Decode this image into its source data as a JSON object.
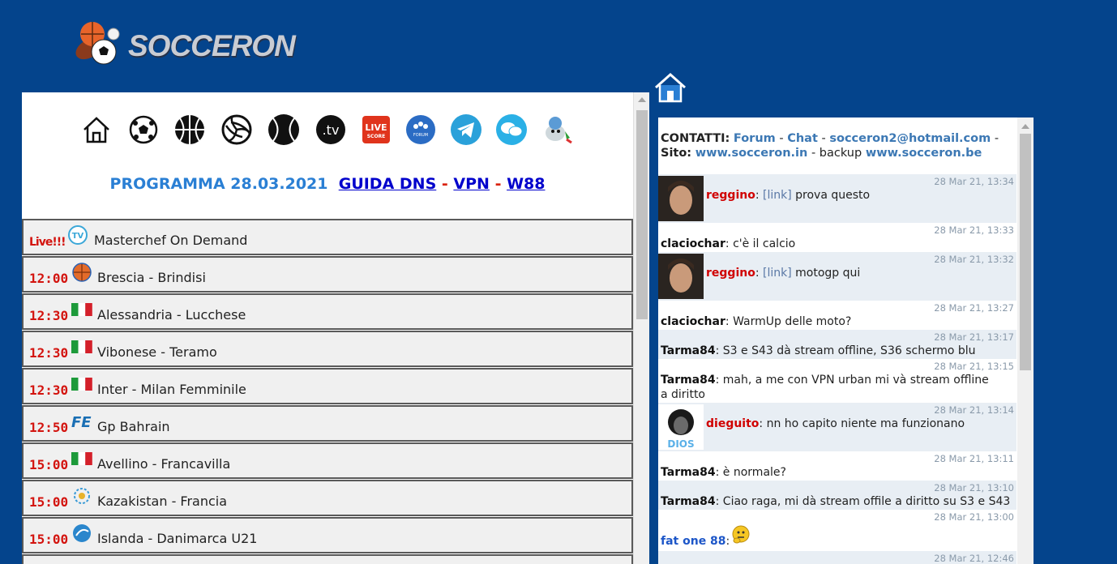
{
  "logo": {
    "text": "SOCCERON"
  },
  "nav_icons": [
    "home-icon",
    "soccer-ball-icon",
    "basketball-icon",
    "volleyball-icon",
    "tennis-ball-icon",
    "tv-icon",
    "live-score-icon",
    "forum-icon",
    "telegram-icon",
    "chat-bubble-icon",
    "mascot-icon"
  ],
  "live_score_label": {
    "line1": "LIVE",
    "line2": "SCORE"
  },
  "tv_label": ".tv",
  "forum_label": "FORUM",
  "programma": {
    "title": "PROGRAMMA 28.03.2021",
    "links": [
      "GUIDA DNS",
      "VPN",
      "W88"
    ],
    "sep": "-"
  },
  "events": [
    {
      "time": "Live!!!",
      "icon": "tv-channel-icon",
      "title": "Masterchef On Demand"
    },
    {
      "time": "12:00",
      "icon": "basketball-icon",
      "title": "Brescia - Brindisi"
    },
    {
      "time": "12:30",
      "icon": "italy-flag-icon",
      "title": "Alessandria - Lucchese"
    },
    {
      "time": "12:30",
      "icon": "italy-flag-icon",
      "title": "Vibonese - Teramo"
    },
    {
      "time": "12:30",
      "icon": "italy-flag-icon",
      "title": "Inter - Milan Femminile"
    },
    {
      "time": "12:50",
      "icon": "formula-e-icon",
      "title": "Gp Bahrain"
    },
    {
      "time": "15:00",
      "icon": "italy-flag-icon",
      "title": "Avellino - Francavilla"
    },
    {
      "time": "15:00",
      "icon": "world-cup-qualifier-icon",
      "title": "Kazakistan - Francia"
    },
    {
      "time": "15:00",
      "icon": "under21-icon",
      "title": "Islanda - Danimarca U21"
    }
  ],
  "chat": {
    "contacts_label": "CONTATTI:",
    "forum": "Forum",
    "chat": "Chat",
    "email": "socceron2@hotmail.com",
    "sito_label": "Sito:",
    "site1": "www.socceron.in",
    "backup_label": "backup",
    "site2": "www.socceron.be",
    "messages": [
      {
        "user": "reggino",
        "ts": "28 Mar 21, 13:34",
        "text": "prova questo",
        "link": "[link]"
      },
      {
        "user": "claciochar",
        "ts": "28 Mar 21, 13:33",
        "text": "c'è il calcio"
      },
      {
        "user": "reggino",
        "ts": "28 Mar 21, 13:32",
        "text": "motogp qui",
        "link": "[link]"
      },
      {
        "user": "claciochar",
        "ts": "28 Mar 21, 13:27",
        "text": "WarmUp delle moto?"
      },
      {
        "user": "Tarma84",
        "ts": "28 Mar 21, 13:17",
        "text": "S3 e S43 dà stream offline, S36 schermo blu"
      },
      {
        "user": "Tarma84",
        "ts": "28 Mar 21, 13:15",
        "text": "mah, a me con VPN urban mi và stream offline a diritto"
      },
      {
        "user": "dieguito",
        "ts": "28 Mar 21, 13:14",
        "text": "nn ho capito niente ma funzionano"
      },
      {
        "user": "Tarma84",
        "ts": "28 Mar 21, 13:11",
        "text": "è normale?"
      },
      {
        "user": "Tarma84",
        "ts": "28 Mar 21, 13:10",
        "text": "Ciao raga, mi dà stream offile a diritto su S3 e S43"
      },
      {
        "user": "fat one 88",
        "ts": "28 Mar 21, 13:00",
        "text": ""
      },
      {
        "ts": "28 Mar 21, 12:46"
      }
    ],
    "colon": ":",
    "avatar_caption": "DIOS"
  }
}
